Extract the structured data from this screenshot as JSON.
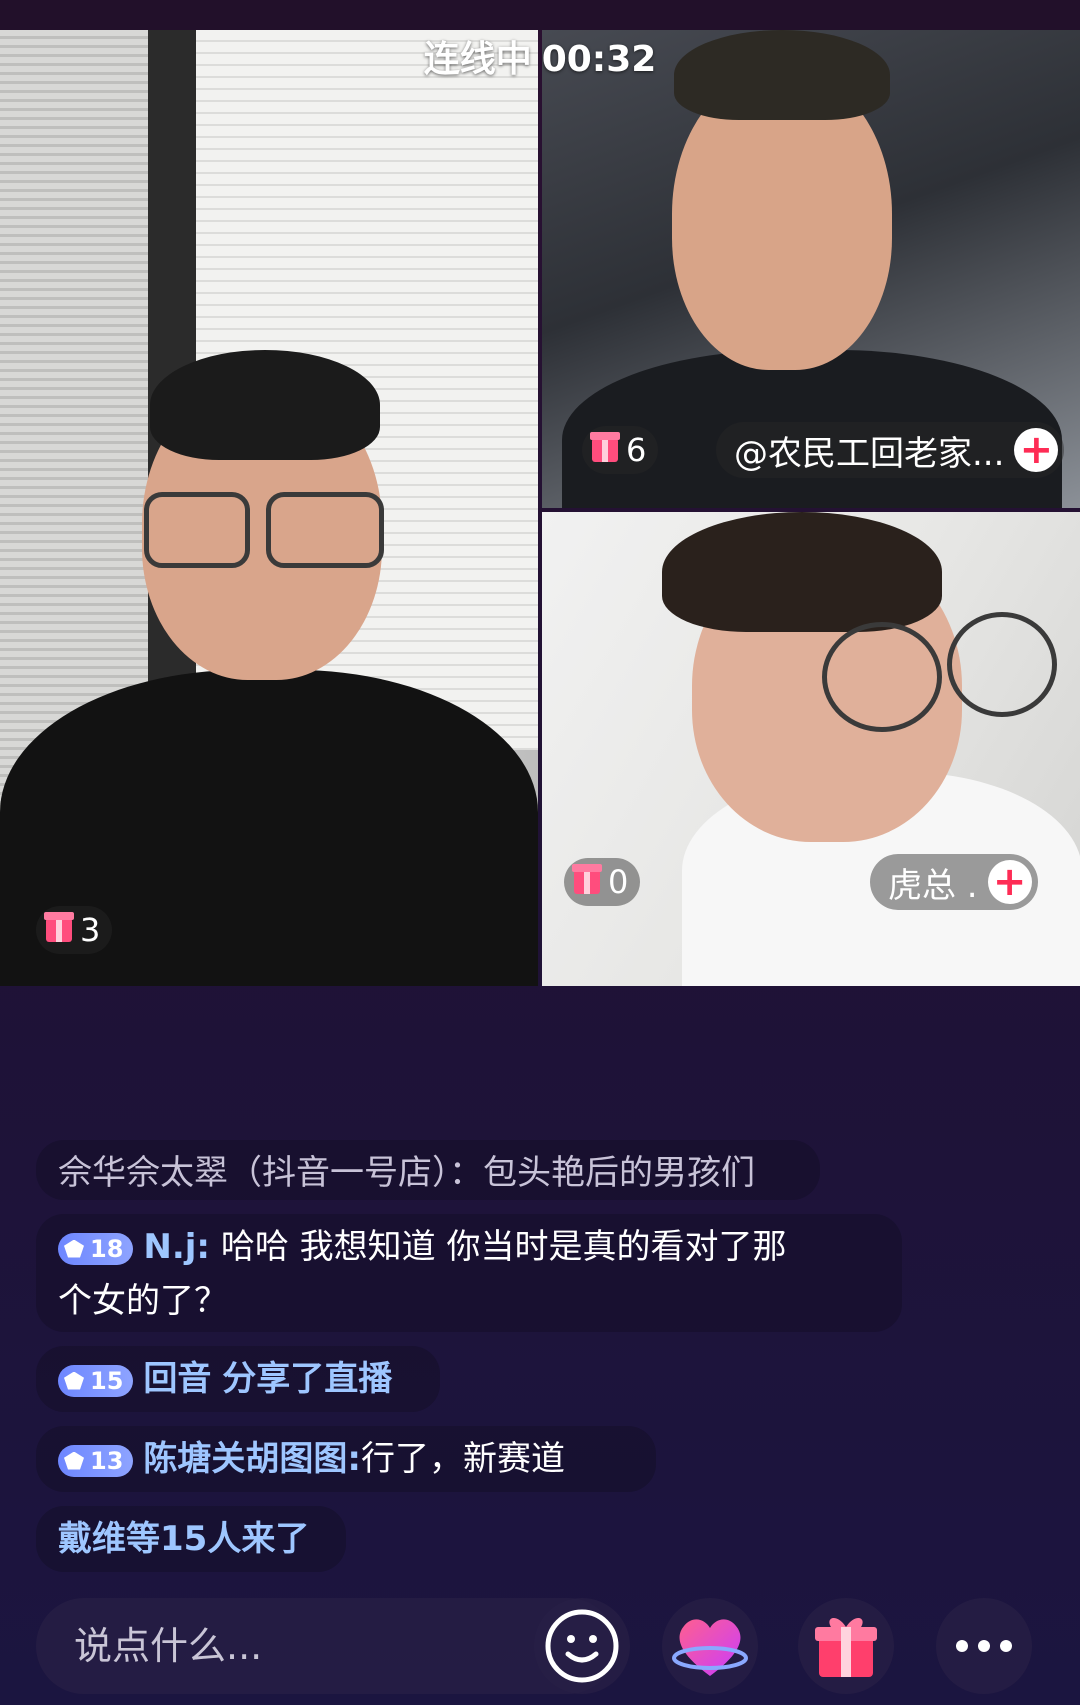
{
  "call": {
    "status_label": "连线中",
    "timer": "00:32"
  },
  "streams": {
    "host": {
      "gift_count": "3"
    },
    "guest1": {
      "gift_count": "6",
      "name": "@农民工回老家..."
    },
    "guest2": {
      "gift_count": "0",
      "name": "虎总 ."
    }
  },
  "chat": {
    "messages": [
      {
        "type": "system",
        "user": "佘华佘太翠（抖音一号店）：",
        "text": "包头艳后的男孩们"
      },
      {
        "type": "comment",
        "level": "18",
        "user": "N.j:",
        "text": "哈哈 我想知道 你当时是真的看对了那",
        "text_cont": "个女的了？"
      },
      {
        "type": "share",
        "level": "15",
        "user": "回音",
        "text": "分享了直播"
      },
      {
        "type": "comment",
        "level": "13",
        "user": "陈塘关胡图图:",
        "text": "行了，新赛道"
      },
      {
        "type": "enter",
        "text": "戴维等15人来了"
      }
    ]
  },
  "input": {
    "placeholder": "说点什么..."
  },
  "colors": {
    "accent": "#fe2c55",
    "username": "#9ec6ff",
    "gift": "#ff4d7d",
    "background": "#1f1236"
  },
  "icons": {
    "emoji": "smile-icon",
    "heart": "heart-icon",
    "gift": "gift-icon",
    "more": "more-icon"
  }
}
